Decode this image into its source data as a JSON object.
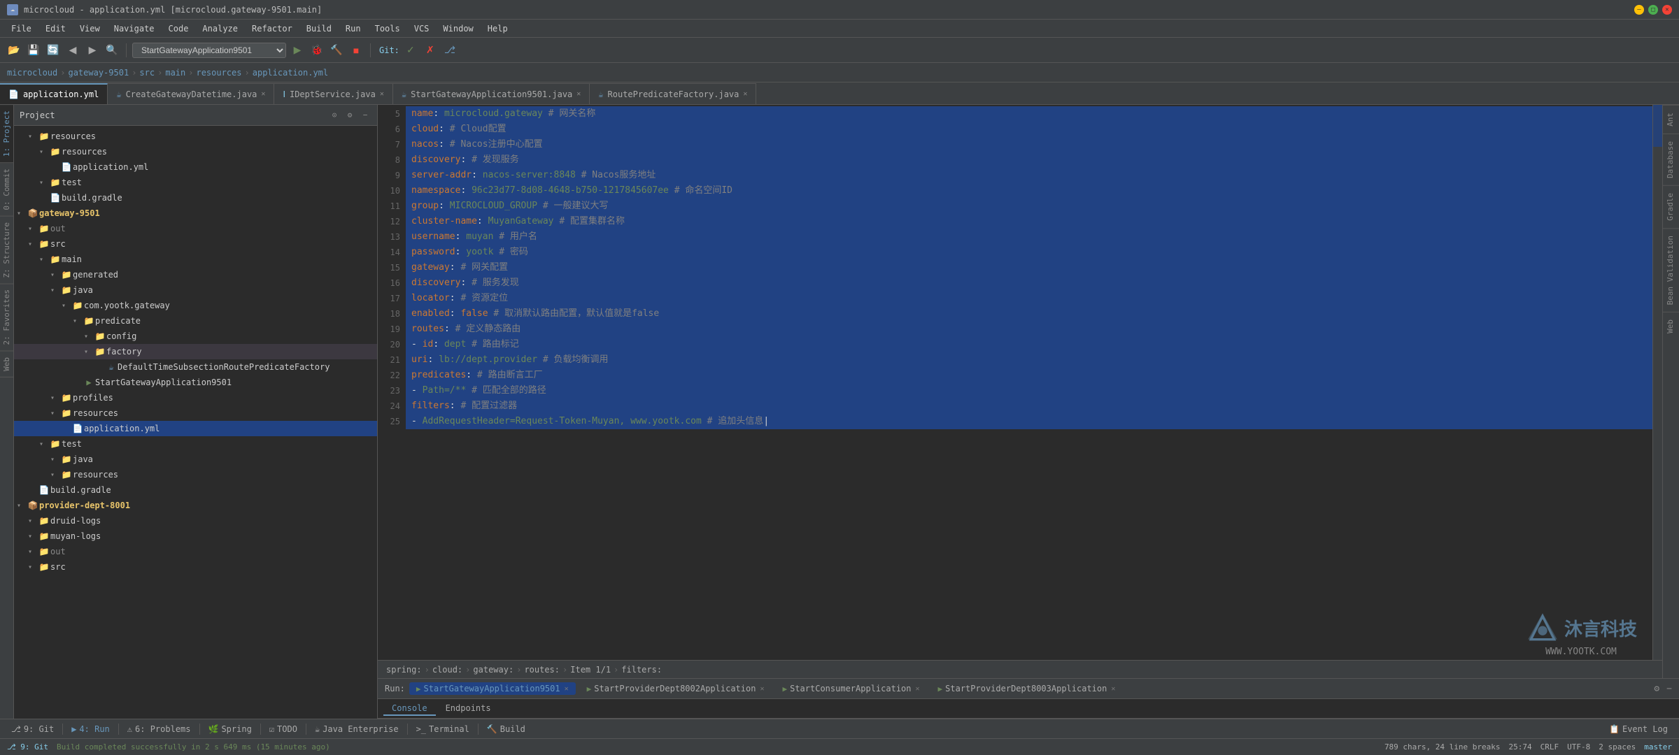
{
  "titleBar": {
    "title": "microcloud - application.yml [microcloud.gateway-9501.main]",
    "appIcon": "☁"
  },
  "menuBar": {
    "items": [
      "File",
      "Edit",
      "View",
      "Navigate",
      "Code",
      "Analyze",
      "Refactor",
      "Build",
      "Run",
      "Tools",
      "VCS",
      "Window",
      "Help"
    ]
  },
  "toolbar": {
    "runConfig": "StartGatewayApplication9501",
    "gitLabel": "Git:"
  },
  "breadcrumb": {
    "items": [
      "microcloud",
      "gateway-9501",
      "src",
      "main",
      "resources",
      "application.yml"
    ]
  },
  "tabs": [
    {
      "label": "application.yml",
      "type": "yml",
      "active": true,
      "closable": false
    },
    {
      "label": "CreateGatewayDatetime.java",
      "type": "java",
      "active": false,
      "closable": true
    },
    {
      "label": "IDeptService.java",
      "type": "interface",
      "active": false,
      "closable": true
    },
    {
      "label": "StartGatewayApplication9501.java",
      "type": "java",
      "active": false,
      "closable": true
    },
    {
      "label": "RoutePredicateFactory.java",
      "type": "java",
      "active": false,
      "closable": true
    }
  ],
  "codeLines": [
    {
      "num": "5",
      "content": "  name: microcloud.gateway # 网关名称",
      "selected": false
    },
    {
      "num": "6",
      "content": "  cloud: # Cloud配置",
      "selected": false
    },
    {
      "num": "7",
      "content": "    nacos: # Nacos注册中心配置",
      "selected": false
    },
    {
      "num": "8",
      "content": "      discovery: # 发现服务",
      "selected": false
    },
    {
      "num": "9",
      "content": "        server-addr: nacos-server:8848 # Nacos服务地址",
      "selected": false
    },
    {
      "num": "10",
      "content": "        namespace: 96c23d77-8d08-4648-b750-1217845607ee # 命名空间ID",
      "selected": false
    },
    {
      "num": "11",
      "content": "        group: MICROCLOUD_GROUP # 一般建议大写",
      "selected": false
    },
    {
      "num": "12",
      "content": "        cluster-name: MuyanGateway # 配置集群名称",
      "selected": false
    },
    {
      "num": "13",
      "content": "        username: muyan # 用户名",
      "selected": false
    },
    {
      "num": "14",
      "content": "        password: yootk # 密码",
      "selected": false
    },
    {
      "num": "15",
      "content": "    gateway: # 网关配置",
      "selected": false
    },
    {
      "num": "16",
      "content": "      discovery: # 服务发现",
      "selected": false
    },
    {
      "num": "17",
      "content": "        locator: # 资源定位",
      "selected": false
    },
    {
      "num": "18",
      "content": "          enabled: false # 取消默认路由配置，默认值就是false",
      "selected": false
    },
    {
      "num": "19",
      "content": "      routes: # 定义静态路由",
      "selected": false
    },
    {
      "num": "20",
      "content": "        - id: dept # 路由标记",
      "selected": false
    },
    {
      "num": "21",
      "content": "          uri: lb://dept.provider # 负载均衡调用",
      "selected": false
    },
    {
      "num": "22",
      "content": "          predicates: # 路由断言工厂",
      "selected": false
    },
    {
      "num": "23",
      "content": "            - Path=/** # 匹配全部的路径",
      "selected": false
    },
    {
      "num": "24",
      "content": "          filters: # 配置过滤器",
      "selected": false
    },
    {
      "num": "25",
      "content": "            - AddRequestHeader=Request-Token-Muyan, www.yootk.com # 追加头信息",
      "selected": false
    }
  ],
  "editorStatus": {
    "breadcrumb": [
      "spring:",
      "cloud:",
      "gateway:",
      "routes:",
      "Item 1/1",
      "filters:"
    ]
  },
  "runBar": {
    "label": "Run:",
    "tabs": [
      {
        "label": "StartGatewayApplication9501",
        "icon": "▶",
        "active": true
      },
      {
        "label": "StartProviderDept8002Application",
        "icon": "▶",
        "active": false
      },
      {
        "label": "StartConsumerApplication",
        "icon": "▶",
        "active": false
      },
      {
        "label": "StartProviderDept8003Application",
        "icon": "▶",
        "active": false
      }
    ]
  },
  "consoleTabs": [
    {
      "label": "Console",
      "active": true
    },
    {
      "label": "Endpoints",
      "active": false
    }
  ],
  "bottomTools": [
    {
      "label": "9: Git",
      "icon": "⎇"
    },
    {
      "label": "4: Run",
      "icon": "▶",
      "active": true
    },
    {
      "label": "6: Problems",
      "icon": "⚠"
    },
    {
      "label": "Spring",
      "icon": "🌿"
    },
    {
      "label": "TODO",
      "icon": "☑"
    },
    {
      "label": "Java Enterprise",
      "icon": "☕"
    },
    {
      "label": "Terminal",
      "icon": ">_"
    },
    {
      "label": "Build",
      "icon": "🔨"
    },
    {
      "label": "Event Log",
      "icon": "📋"
    }
  ],
  "statusBar": {
    "git": "master",
    "buildStatus": "Build completed successfully in 2 s 649 ms (15 minutes ago)",
    "position": "25:74",
    "lineEnding": "CRLF",
    "encoding": "UTF-8",
    "indentation": "2 spaces",
    "chars": "789 chars, 24 line breaks"
  },
  "projectTree": {
    "items": [
      {
        "indent": 0,
        "arrow": "▾",
        "icon": "📁",
        "iconClass": "folder-icon-blue",
        "label": "resources",
        "selected": false
      },
      {
        "indent": 1,
        "arrow": "▾",
        "icon": "📁",
        "iconClass": "folder-icon",
        "label": "resources",
        "selected": false
      },
      {
        "indent": 2,
        "arrow": " ",
        "icon": "📄",
        "iconClass": "yml-icon",
        "label": "application.yml",
        "selected": false
      },
      {
        "indent": 1,
        "arrow": "▾",
        "icon": "📁",
        "iconClass": "folder-icon",
        "label": "test",
        "selected": false
      },
      {
        "indent": 1,
        "arrow": " ",
        "icon": "📄",
        "iconClass": "gradle-icon",
        "label": "build.gradle",
        "selected": false
      },
      {
        "indent": 0,
        "arrow": "▾",
        "icon": "📦",
        "iconClass": "folder-icon-blue",
        "label": "gateway-9501",
        "selected": false
      },
      {
        "indent": 1,
        "arrow": "▾",
        "icon": "📁",
        "iconClass": "folder-icon-orange",
        "label": "out",
        "selected": false
      },
      {
        "indent": 1,
        "arrow": "▾",
        "icon": "📁",
        "iconClass": "src-folder",
        "label": "src",
        "selected": false
      },
      {
        "indent": 2,
        "arrow": "▾",
        "icon": "📁",
        "iconClass": "folder-icon",
        "label": "main",
        "selected": false
      },
      {
        "indent": 3,
        "arrow": "▾",
        "icon": "📁",
        "iconClass": "folder-icon-blue",
        "label": "generated",
        "selected": false
      },
      {
        "indent": 3,
        "arrow": "▾",
        "icon": "📁",
        "iconClass": "folder-icon-blue",
        "label": "java",
        "selected": false
      },
      {
        "indent": 4,
        "arrow": "▾",
        "icon": "📁",
        "iconClass": "folder-icon",
        "label": "com.yootk.gateway",
        "selected": false
      },
      {
        "indent": 5,
        "arrow": "▾",
        "icon": "📁",
        "iconClass": "folder-icon",
        "label": "predicate",
        "selected": false
      },
      {
        "indent": 6,
        "arrow": "▾",
        "icon": "📁",
        "iconClass": "config-folder",
        "label": "config",
        "selected": false
      },
      {
        "indent": 6,
        "arrow": "▾",
        "icon": "📁",
        "iconClass": "folder-icon",
        "label": "factory",
        "selected": false,
        "highlighted": true
      },
      {
        "indent": 7,
        "arrow": " ",
        "icon": "☕",
        "iconClass": "java-icon",
        "label": "DefaultTimeSubsectionRoutePredicateFactory",
        "selected": false
      },
      {
        "indent": 5,
        "arrow": " ",
        "icon": "▶",
        "iconClass": "java-icon",
        "label": "StartGatewayApplication9501",
        "selected": false
      },
      {
        "indent": 3,
        "arrow": "▾",
        "icon": "📁",
        "iconClass": "folder-icon-blue",
        "label": "profiles",
        "selected": false
      },
      {
        "indent": 3,
        "arrow": "▾",
        "icon": "📁",
        "iconClass": "folder-icon",
        "label": "resources",
        "selected": false
      },
      {
        "indent": 4,
        "arrow": " ",
        "icon": "📄",
        "iconClass": "yml-icon",
        "label": "application.yml",
        "selected": true
      },
      {
        "indent": 2,
        "arrow": "▾",
        "icon": "📁",
        "iconClass": "folder-icon",
        "label": "test",
        "selected": false
      },
      {
        "indent": 3,
        "arrow": "▾",
        "icon": "📁",
        "iconClass": "folder-icon-blue",
        "label": "java",
        "selected": false
      },
      {
        "indent": 3,
        "arrow": "▾",
        "icon": "📁",
        "iconClass": "folder-icon",
        "label": "resources",
        "selected": false
      },
      {
        "indent": 1,
        "arrow": " ",
        "icon": "📄",
        "iconClass": "gradle-icon",
        "label": "build.gradle",
        "selected": false
      },
      {
        "indent": 0,
        "arrow": "▾",
        "icon": "📦",
        "iconClass": "folder-icon-blue",
        "label": "provider-dept-8001",
        "selected": false
      },
      {
        "indent": 1,
        "arrow": "▾",
        "icon": "📁",
        "iconClass": "folder-icon",
        "label": "druid-logs",
        "selected": false
      },
      {
        "indent": 1,
        "arrow": "▾",
        "icon": "📁",
        "iconClass": "folder-icon",
        "label": "muyan-logs",
        "selected": false
      },
      {
        "indent": 1,
        "arrow": "▾",
        "icon": "📁",
        "iconClass": "folder-icon-orange",
        "label": "out",
        "selected": false
      },
      {
        "indent": 1,
        "arrow": "▾",
        "icon": "📁",
        "iconClass": "src-folder",
        "label": "src",
        "selected": false
      }
    ]
  },
  "rightTabs": [
    "Ant",
    "Database",
    "Gradle",
    "Bean Validation",
    "Web"
  ],
  "watermark": {
    "company": "沐言科技",
    "url": "WWW.YOOTK.COM"
  }
}
